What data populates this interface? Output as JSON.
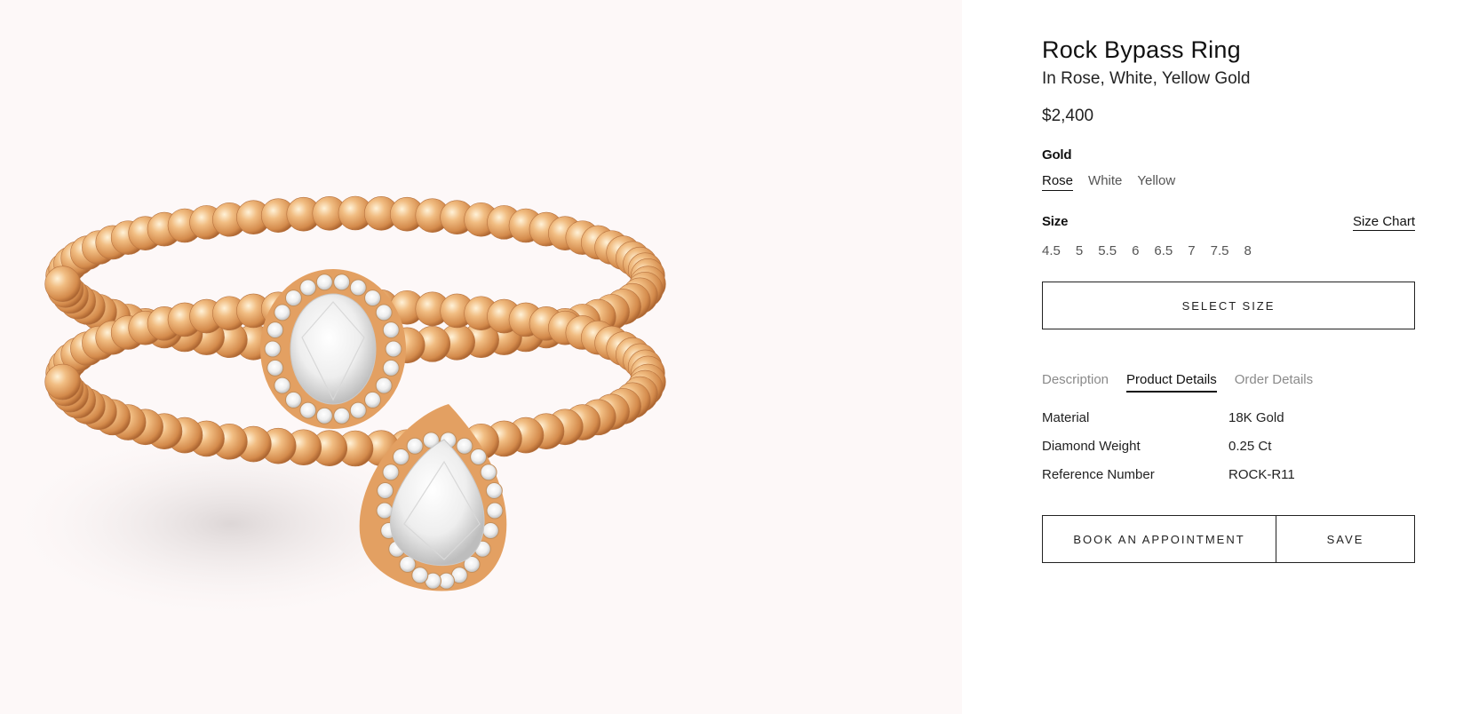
{
  "product": {
    "title": "Rock Bypass Ring",
    "subtitle": "In Rose, White, Yellow Gold",
    "price": "$2,400"
  },
  "gold": {
    "label": "Gold",
    "options": [
      "Rose",
      "White",
      "Yellow"
    ],
    "selected": "Rose"
  },
  "size": {
    "label": "Size",
    "chart_link": "Size Chart",
    "options": [
      "4.5",
      "5",
      "5.5",
      "6",
      "6.5",
      "7",
      "7.5",
      "8"
    ]
  },
  "select_size_button": "SELECT SIZE",
  "tabs": {
    "items": [
      "Description",
      "Product Details",
      "Order Details"
    ],
    "active": "Product Details"
  },
  "details": [
    {
      "key": "Material",
      "value": "18K Gold"
    },
    {
      "key": "Diamond Weight",
      "value": "0.25 Ct"
    },
    {
      "key": "Reference Number",
      "value": "ROCK-R11"
    }
  ],
  "actions": {
    "book": "BOOK AN APPOINTMENT",
    "save": "SAVE"
  },
  "colors": {
    "image_background": "#fdf8f8",
    "rose_gold": "#e8a76a"
  }
}
